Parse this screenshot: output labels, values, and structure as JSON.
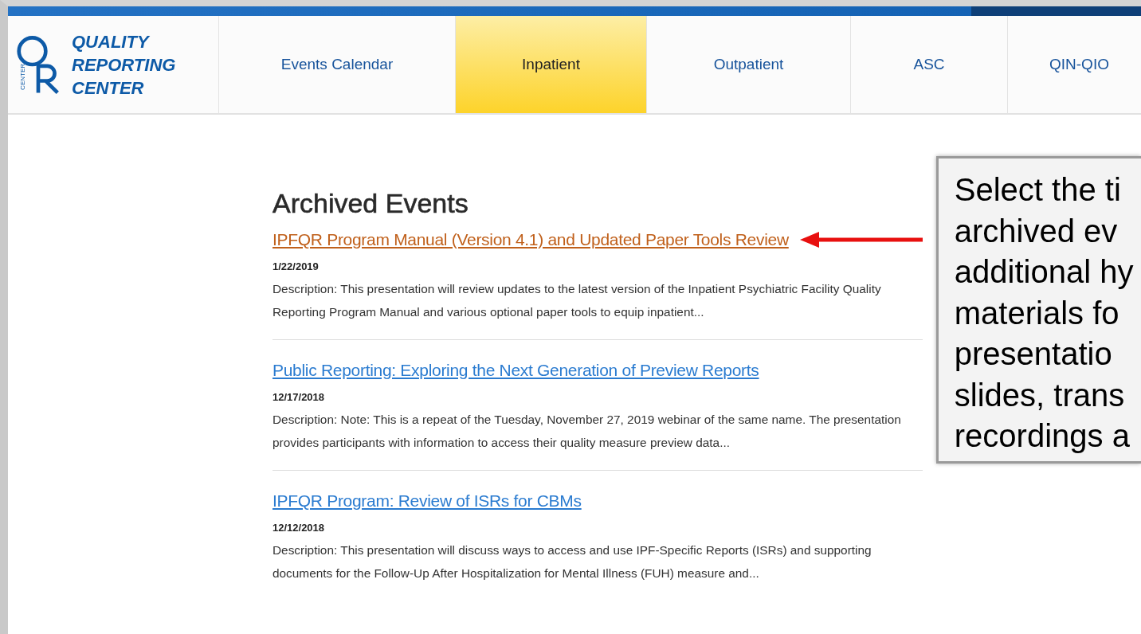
{
  "logo": {
    "text_lines": [
      "QUALITY",
      "REPORTING",
      "CENTER"
    ],
    "mark_caption": "CENTER"
  },
  "nav": [
    {
      "label": "Events Calendar",
      "selected": false
    },
    {
      "label": "Inpatient",
      "selected": true
    },
    {
      "label": "Outpatient",
      "selected": false
    },
    {
      "label": "ASC",
      "selected": false
    },
    {
      "label": "QIN-QIO",
      "selected": false
    }
  ],
  "heading": "Archived Events",
  "events": [
    {
      "title": "IPFQR Program Manual (Version 4.1) and Updated Paper Tools Review",
      "visited": true,
      "pointed": true,
      "date": "1/22/2019",
      "description": "Description: This presentation will review updates to the latest version of the Inpatient Psychiatric Facility Quality Reporting Program Manual and various optional paper tools to equip inpatient..."
    },
    {
      "title": "Public Reporting: Exploring the Next Generation of Preview Reports",
      "visited": false,
      "pointed": false,
      "date": "12/17/2018",
      "description": "Description: Note: This is a repeat of the Tuesday, November 27, 2019 webinar of the same name. The presentation provides participants with information to access their quality measure preview data..."
    },
    {
      "title": "IPFQR Program: Review of ISRs for CBMs",
      "visited": false,
      "pointed": false,
      "date": "12/12/2018",
      "description": "Description:  This presentation will discuss ways to access and use IPF-Specific Reports (ISRs) and supporting documents for the Follow-Up After Hospitalization for Mental Illness (FUH) measure and..."
    }
  ],
  "callout": {
    "lines": [
      "Select the ti",
      "archived ev",
      "additional hy",
      "materials fo",
      "presentatio",
      "slides, trans",
      "recordings a"
    ]
  }
}
